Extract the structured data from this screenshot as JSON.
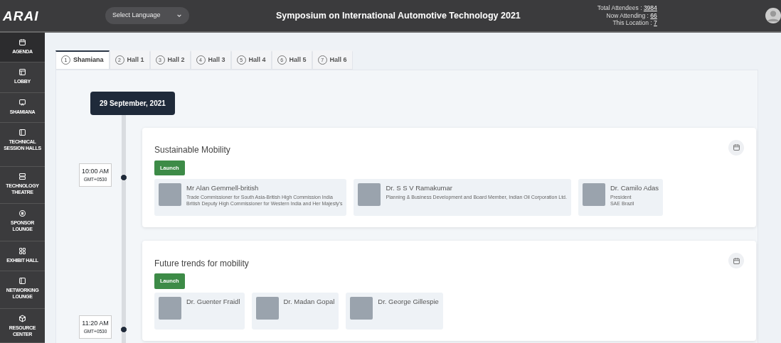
{
  "header": {
    "logo": "ARAI",
    "language_select": {
      "value": "Select Language"
    },
    "title": "Symposium on International Automotive Technology 2021",
    "stats": [
      {
        "label": "Total Attendees :",
        "value": "3984"
      },
      {
        "label": "Now Attending :",
        "value": "66"
      },
      {
        "label": "This Location :",
        "value": "7"
      }
    ]
  },
  "sidebar": {
    "items": [
      {
        "label": "AGENDA",
        "selected": true
      },
      {
        "label": "LOBBY",
        "selected": false
      },
      {
        "label": "SHAMIANA",
        "selected": false
      },
      {
        "label": "TECHNICAL SESSION HALLS",
        "selected": false
      },
      {
        "label": "TECHNOLOGY THEATRE",
        "selected": false
      },
      {
        "label": "SPONSOR LOUNGE",
        "selected": false
      },
      {
        "label": "EXHIBIT HALL",
        "selected": false
      },
      {
        "label": "NETWORKING LOUNGE",
        "selected": false
      },
      {
        "label": "RESOURCE CENTER",
        "selected": false
      }
    ]
  },
  "tabs": [
    {
      "number": "1",
      "label": "Shamiana",
      "selected": true
    },
    {
      "number": "2",
      "label": "Hall 1",
      "selected": false
    },
    {
      "number": "3",
      "label": "Hall 2",
      "selected": false
    },
    {
      "number": "4",
      "label": "Hall 3",
      "selected": false
    },
    {
      "number": "5",
      "label": "Hall 4",
      "selected": false
    },
    {
      "number": "6",
      "label": "Hall 5",
      "selected": false
    },
    {
      "number": "7",
      "label": "Hall 6",
      "selected": false
    }
  ],
  "date": "29 September, 2021",
  "sessions": [
    {
      "time": "10:00 AM",
      "timezone": "GMT+0530",
      "title": "Sustainable Mobility",
      "button": "Launch",
      "speakers": [
        {
          "name": "Mr Alan Gemmell-british",
          "lines": [
            "Trade Commissioner for South Asia-British High Commission India",
            "British Deputy High Commissioner for Western India and Her Majesty's"
          ]
        },
        {
          "name": "Dr. S S V Ramakumar",
          "lines": [
            "Planning & Business Development and Board Member, Indian Oil Corporation Ltd."
          ]
        },
        {
          "name": "Dr. Camilo Adas",
          "lines": [
            "President",
            "SAE Brazil"
          ]
        }
      ]
    },
    {
      "time": "11:20 AM",
      "timezone": "GMT+0530",
      "title": "Future trends for mobility",
      "button": "Launch",
      "speakers": [
        {
          "name": "Dr. Guenter Fraidl"
        },
        {
          "name": "Dr. Madan Gopal"
        },
        {
          "name": "Dr. George Gillespie"
        }
      ]
    }
  ]
}
